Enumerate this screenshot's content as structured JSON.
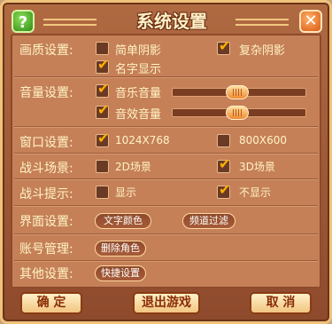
{
  "dialog": {
    "title": "系统设置",
    "help_label": "?",
    "close_label": "✕"
  },
  "quality": {
    "label": "画质设置:",
    "options": [
      {
        "label": "简单阴影",
        "checked": false
      },
      {
        "label": "复杂阴影",
        "checked": true
      },
      {
        "label": "名字显示",
        "checked": true
      }
    ]
  },
  "volume": {
    "label": "音量设置:",
    "music": {
      "label": "音乐音量",
      "checked": true,
      "level": 0.48
    },
    "effects": {
      "label": "音效音量",
      "checked": true,
      "level": 0.48
    }
  },
  "window": {
    "label": "窗口设置:",
    "options": [
      {
        "label": "1024X768",
        "checked": true
      },
      {
        "label": "800X600",
        "checked": false
      }
    ]
  },
  "battle_scene": {
    "label": "战斗场景:",
    "options": [
      {
        "label": "2D场景",
        "checked": false
      },
      {
        "label": "3D场景",
        "checked": true
      }
    ]
  },
  "battle_hint": {
    "label": "战斗提示:",
    "options": [
      {
        "label": "显示",
        "checked": false
      },
      {
        "label": "不显示",
        "checked": true
      }
    ]
  },
  "interface": {
    "label": "界面设置:",
    "buttons": [
      "文字颜色",
      "频道过滤"
    ]
  },
  "account": {
    "label": "账号管理:",
    "buttons": [
      "删除角色"
    ]
  },
  "other": {
    "label": "其他设置:",
    "buttons": [
      "快捷设置"
    ]
  },
  "footer": {
    "confirm": "确 定",
    "exit": "退出游戏",
    "cancel": "取 消"
  },
  "colors": {
    "panel": "#c58058",
    "text": "#fff3c4",
    "check": "#ffb000"
  }
}
